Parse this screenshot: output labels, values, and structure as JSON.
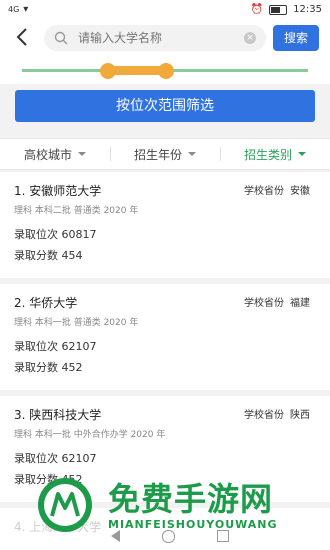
{
  "status": {
    "signal": "4G",
    "time": "12:35"
  },
  "search": {
    "placeholder": "请输入大学名称",
    "button": "搜索"
  },
  "slider": {
    "range_low": 0.3,
    "range_high": 0.5
  },
  "filter_button": "按位次范围筛选",
  "tabs": [
    {
      "label": "高校城市",
      "active": false
    },
    {
      "label": "招生年份",
      "active": false
    },
    {
      "label": "招生类别",
      "active": true
    }
  ],
  "results": [
    {
      "title": "1. 安徽师范大学",
      "prov_label": "学校省份",
      "prov": "安徽",
      "meta": "理科  本科二批  普通类 2020 年",
      "rank": "录取位次  60817",
      "score": "录取分数  454"
    },
    {
      "title": "2. 华侨大学",
      "prov_label": "学校省份",
      "prov": "福建",
      "meta": "理科  本科一批  普通类 2020 年",
      "rank": "录取位次  62107",
      "score": "录取分数  452"
    },
    {
      "title": "3. 陕西科技大学",
      "prov_label": "学校省份",
      "prov": "陕西",
      "meta": "理科  本科一批  中外合作办学 2020 年",
      "rank": "录取位次  62107",
      "score": "录取分数  452"
    }
  ],
  "partial_item": "4. 上海海事大学",
  "watermark": {
    "main": "免费手游网",
    "sub": "MIANFEISHOUYOUWANG"
  },
  "colors": {
    "primary": "#2f72e0",
    "accent_green": "#2aa35a",
    "slider": "#f0a93a"
  }
}
